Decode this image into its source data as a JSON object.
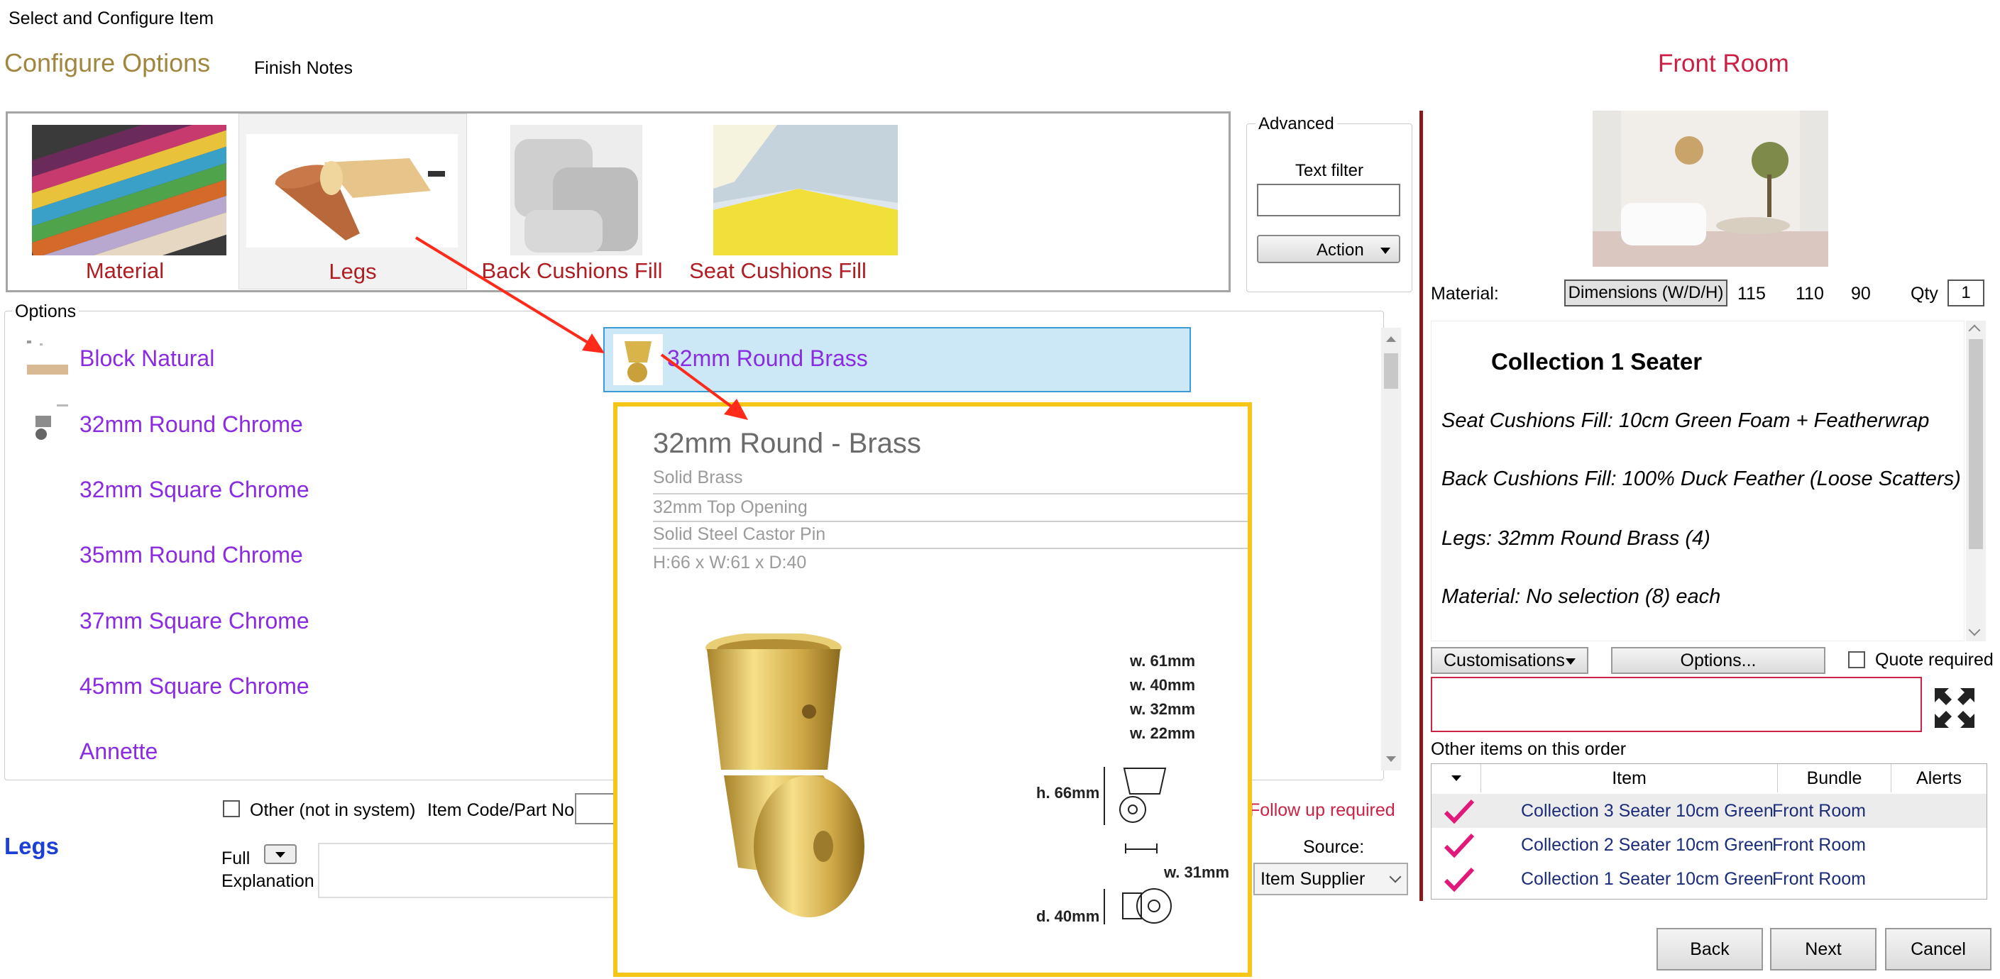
{
  "window_title": "Select and Configure Item",
  "header": {
    "configure_options": "Configure Options",
    "finish_notes": "Finish Notes",
    "room_title": "Front Room"
  },
  "categories": [
    {
      "label": "Material"
    },
    {
      "label": "Legs",
      "selected": true
    },
    {
      "label": "Back Cushions Fill"
    },
    {
      "label": "Seat Cushions Fill"
    }
  ],
  "advanced": {
    "legend": "Advanced",
    "text_filter_label": "Text filter",
    "text_filter_value": "",
    "action_label": "Action"
  },
  "options": {
    "legend": "Options",
    "items": [
      {
        "label": "Block Natural"
      },
      {
        "label": "32mm Round Chrome"
      },
      {
        "label": "32mm Square Chrome"
      },
      {
        "label": "35mm Round Chrome"
      },
      {
        "label": "37mm Square Chrome"
      },
      {
        "label": "45mm Square Chrome"
      },
      {
        "label": "Annette"
      }
    ],
    "selected_label": "32mm Round Brass"
  },
  "popup": {
    "title": "32mm Round - Brass",
    "lines": [
      "Solid Brass",
      "32mm Top Opening",
      "Solid Steel Castor Pin",
      "H:66 x W:61 x D:40"
    ],
    "dims": {
      "w1": "w. 61mm",
      "w2": "w. 40mm",
      "w3": "w. 32mm",
      "w4": "w. 22mm",
      "h": "h. 66mm",
      "w5": "w. 31mm",
      "d": "d. 40mm"
    }
  },
  "bottom": {
    "legs_title": "Legs",
    "other_label": "Other (not in system)",
    "item_code_label": "Item Code/Part No",
    "full_label": "Full",
    "explanation_label": "Explanation",
    "follow_up": "Follow up required",
    "source_label": "Source:",
    "source_value": "Item Supplier"
  },
  "right": {
    "material_label": "Material:",
    "dims_button": "Dimensions (W/D/H)",
    "width": "115",
    "depth": "110",
    "height": "90",
    "qty_label": "Qty",
    "qty_value": "1",
    "summary_title": "Collection 1 Seater",
    "summary_lines": [
      "Seat Cushions Fill: 10cm Green Foam + Featherwrap",
      "Back Cushions Fill: 100% Duck Feather (Loose Scatters)",
      "Legs: 32mm Round Brass (4)",
      "Material: No selection (8) each"
    ],
    "customisations": "Customisations",
    "options_btn": "Options...",
    "quote_required": "Quote required",
    "other_items_label": "Other items on this order",
    "grid_headers": [
      "Item",
      "Bundle",
      "Alerts"
    ],
    "grid_rows": [
      {
        "item": "Collection 3 Seater 10cm Green",
        "bundle": "Front Room"
      },
      {
        "item": "Collection 2 Seater 10cm Green",
        "bundle": "Front Room"
      },
      {
        "item": "Collection 1 Seater 10cm Green",
        "bundle": "Front Room"
      }
    ],
    "back": "Back",
    "next": "Next",
    "cancel": "Cancel"
  },
  "colors": {
    "category_label": "#b01d22",
    "option_label": "#8a2be2",
    "popup_border": "#f5c518",
    "room_title": "#cc1f45",
    "annotation_arrow": "#ff2a1a"
  }
}
